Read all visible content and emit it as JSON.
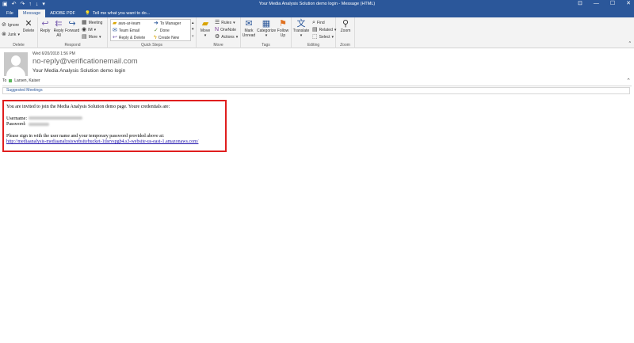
{
  "window": {
    "title": "Your Media Analysis Solution demo login - Message (HTML)",
    "accent": "#2b579a"
  },
  "tabs": [
    {
      "label": "File"
    },
    {
      "label": "Message"
    },
    {
      "label": "ADOBE PDF"
    }
  ],
  "tellme": "Tell me what you want to do...",
  "ribbon": {
    "delete": {
      "ignore": "Ignore",
      "junk": "Junk",
      "delete": "Delete",
      "label": "Delete"
    },
    "respond": {
      "reply": "Reply",
      "reply_all_1": "Reply",
      "reply_all_2": "All",
      "forward": "Forward",
      "meeting": "Meeting",
      "im": "IM",
      "more": "More",
      "label": "Respond"
    },
    "quick_steps": {
      "items": [
        "aws-ar-team",
        "Team Email",
        "Reply & Delete",
        "To Manager",
        "Done",
        "Create New"
      ],
      "label": "Quick Steps"
    },
    "move": {
      "move": "Move",
      "rules": "Rules",
      "onenote": "OneNote",
      "actions": "Actions",
      "label": "Move"
    },
    "tags": {
      "mark_1": "Mark",
      "mark_2": "Unread",
      "categorize": "Categorize",
      "follow_1": "Follow",
      "follow_2": "Up",
      "label": "Tags"
    },
    "editing": {
      "translate": "Translate",
      "find": "Find",
      "related": "Related",
      "select": "Select",
      "label": "Editing"
    },
    "zoom": {
      "zoom": "Zoom",
      "label": "Zoom"
    }
  },
  "message": {
    "date": "Wed 6/20/2018 1:56 PM",
    "sender": "no-reply@verificationemail.com",
    "subject": "Your Media Analysis Solution demo login",
    "to_label": "To",
    "to_name": "Larsen, Kaiser",
    "suggested": "Suggested Meetings"
  },
  "email_body": {
    "line1": "You are invited to join the Media Analysis Solution demo page. Youre credentials are:",
    "username_label": "Username:",
    "password_label": "Password:",
    "line2": "Please sign in with the user name and your temporary password provided above at:",
    "link": "http://mediaanalysis-mediaanalysiswebsitebucket-1tlsrvspgb4.s3-website-us-east-1.amazonaws.com/"
  }
}
